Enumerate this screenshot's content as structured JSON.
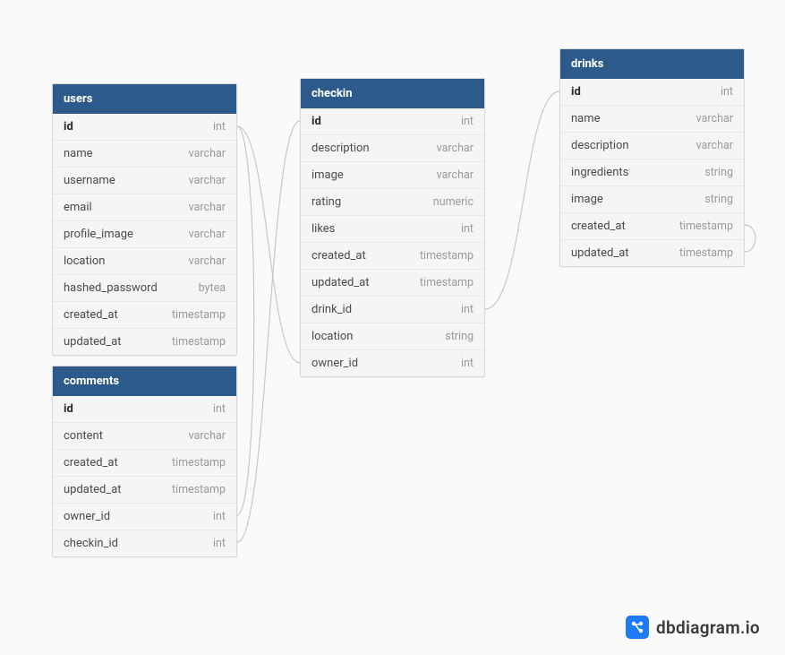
{
  "tables": {
    "users": {
      "name": "users",
      "columns": [
        {
          "name": "id",
          "type": "int",
          "bold": true
        },
        {
          "name": "name",
          "type": "varchar"
        },
        {
          "name": "username",
          "type": "varchar"
        },
        {
          "name": "email",
          "type": "varchar"
        },
        {
          "name": "profile_image",
          "type": "varchar"
        },
        {
          "name": "location",
          "type": "varchar"
        },
        {
          "name": "hashed_password",
          "type": "bytea"
        },
        {
          "name": "created_at",
          "type": "timestamp"
        },
        {
          "name": "updated_at",
          "type": "timestamp"
        }
      ]
    },
    "checkin": {
      "name": "checkin",
      "columns": [
        {
          "name": "id",
          "type": "int",
          "bold": true
        },
        {
          "name": "description",
          "type": "varchar"
        },
        {
          "name": "image",
          "type": "varchar"
        },
        {
          "name": "rating",
          "type": "numeric"
        },
        {
          "name": "likes",
          "type": "int"
        },
        {
          "name": "created_at",
          "type": "timestamp"
        },
        {
          "name": "updated_at",
          "type": "timestamp"
        },
        {
          "name": "drink_id",
          "type": "int"
        },
        {
          "name": "location",
          "type": "string"
        },
        {
          "name": "owner_id",
          "type": "int"
        }
      ]
    },
    "drinks": {
      "name": "drinks",
      "columns": [
        {
          "name": "id",
          "type": "int",
          "bold": true
        },
        {
          "name": "name",
          "type": "varchar"
        },
        {
          "name": "description",
          "type": "varchar"
        },
        {
          "name": "ingredients",
          "type": "string"
        },
        {
          "name": "image",
          "type": "string"
        },
        {
          "name": "created_at",
          "type": "timestamp"
        },
        {
          "name": "updated_at",
          "type": "timestamp"
        }
      ]
    },
    "comments": {
      "name": "comments",
      "columns": [
        {
          "name": "id",
          "type": "int",
          "bold": true
        },
        {
          "name": "content",
          "type": "varchar"
        },
        {
          "name": "created_at",
          "type": "timestamp"
        },
        {
          "name": "updated_at",
          "type": "timestamp"
        },
        {
          "name": "owner_id",
          "type": "int"
        },
        {
          "name": "checkin_id",
          "type": "int"
        }
      ]
    }
  },
  "watermark": {
    "text": "dbdiagram.io"
  }
}
